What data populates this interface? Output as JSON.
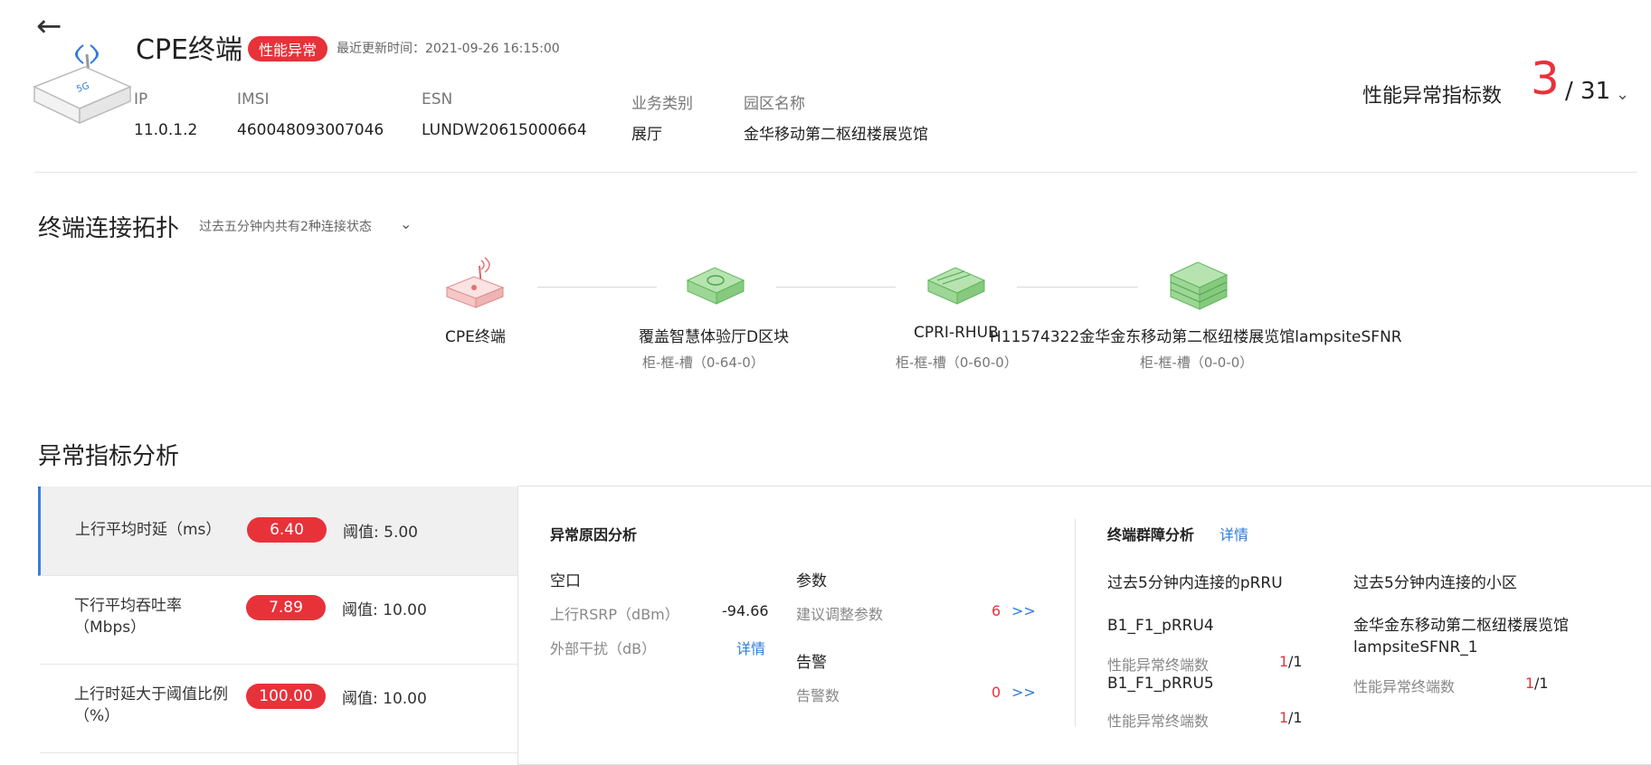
{
  "header": {
    "title": "CPE终端",
    "status_badge": "性能异常",
    "update_time": "最近更新时间：2021-09-26 16:15:00",
    "fields": [
      {
        "label": "IP",
        "value": "11.0.1.2"
      },
      {
        "label": "IMSI",
        "value": "460048093007046"
      },
      {
        "label": "ESN",
        "value": "LUNDW20615000664"
      },
      {
        "label": "业务类别",
        "value": "展厅"
      },
      {
        "label": "园区名称",
        "value": "金华移动第二枢纽楼展览馆"
      }
    ],
    "perf_label": "性能异常指标数",
    "perf_count": "3",
    "perf_total": "/ 31"
  },
  "topology": {
    "title": "终端连接拓扑",
    "subtitle": "过去五分钟内共有2种连接状态",
    "nodes": [
      {
        "label": "CPE终端",
        "sub": ""
      },
      {
        "label": "覆盖智慧体验厅D区块",
        "sub": "柜-框-槽（0-64-0）"
      },
      {
        "label": "CPRI-RHUB",
        "sub": "柜-框-槽（0-60-0）"
      },
      {
        "label": "H11574322金华金东移动第二枢纽楼展览馆lampsiteSFNR",
        "sub": "柜-框-槽（0-0-0）"
      }
    ]
  },
  "analysis": {
    "title": "异常指标分析",
    "metrics": [
      {
        "name": "上行平均时延（ms）",
        "value": "6.40",
        "threshold": "阈值: 5.00"
      },
      {
        "name": "下行平均吞吐率（Mbps）",
        "value": "7.89",
        "threshold": "阈值: 10.00"
      },
      {
        "name": "上行时延大于阈值比例（%）",
        "value": "100.00",
        "threshold": "阈值: 10.00"
      }
    ],
    "cause": {
      "title": "异常原因分析",
      "air_title": "空口",
      "rsrp_label": "上行RSRP（dBm）",
      "rsrp_value": "-94.66",
      "interference_label": "外部干扰（dB）",
      "detail_link": "详情",
      "param_title": "参数",
      "param_label": "建议调整参数",
      "param_value": "6",
      "alarm_title": "告警",
      "alarm_label": "告警数",
      "alarm_value": "0",
      "more": ">>"
    },
    "group": {
      "title": "终端群障分析",
      "detail_link": "详情",
      "prru_head": "过去5分钟内连接的pRRU",
      "cell_head": "过去5分钟内连接的小区",
      "abn_label": "性能异常终端数",
      "prru": [
        {
          "name": "B1_F1_pRRU4",
          "count": "1",
          "total": "/1"
        },
        {
          "name": "B1_F1_pRRU5",
          "count": "1",
          "total": "/1"
        }
      ],
      "cells": [
        {
          "name": "金华金东移动第二枢纽楼展览馆lampsiteSFNR_1",
          "count": "1",
          "total": "/1"
        }
      ]
    }
  }
}
